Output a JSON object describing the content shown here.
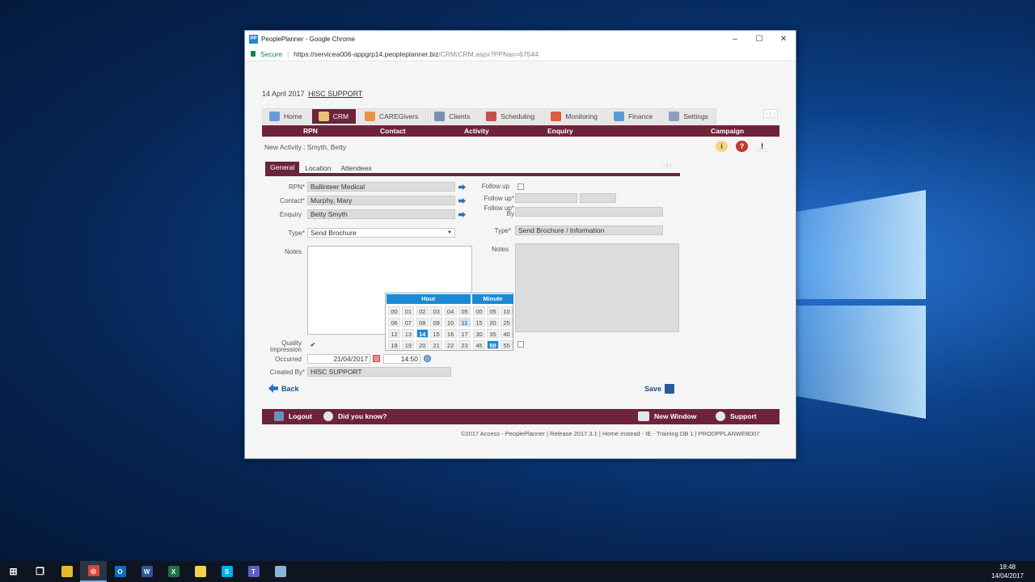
{
  "window": {
    "title": "PeoplePlanner - Google Chrome",
    "logo": "PP",
    "min": "–",
    "max": "☐",
    "close": "✕"
  },
  "address": {
    "secure": "Secure",
    "url_base": "https://servicea006-appgrp14.peopleplanner.biz",
    "url_path": "/CRM/CRM.aspx?PPNav=67544"
  },
  "header": {
    "date": "14 April 2017",
    "user": "HISC SUPPORT"
  },
  "tabs": [
    {
      "label": "Home",
      "icon": "home-icon",
      "color": "#6a9bd8"
    },
    {
      "label": "CRM",
      "icon": "people-icon",
      "color": "#e8c07a"
    },
    {
      "label": "CAREGivers",
      "icon": "person-icon",
      "color": "#e8934a"
    },
    {
      "label": "Clients",
      "icon": "building-icon",
      "color": "#7a8fb0"
    },
    {
      "label": "Scheduling",
      "icon": "calendar-icon",
      "color": "#c0504d"
    },
    {
      "label": "Monitoring",
      "icon": "clock-icon",
      "color": "#d9603b"
    },
    {
      "label": "Finance",
      "icon": "chart-icon",
      "color": "#5b9bd5"
    },
    {
      "label": "Settings",
      "icon": "gear-icon",
      "color": "#8aa0c0"
    }
  ],
  "nav_arrows": "‹ | ›",
  "subnav": [
    "RPN",
    "Contact",
    "Activity",
    "Enquiry",
    "Campaign"
  ],
  "breadcrumb": "New Activity : Smyth, Betty",
  "header_icons": {
    "info": "i",
    "help": "?",
    "warning": "!"
  },
  "form_tabs": [
    "General",
    "Location",
    "Attendees"
  ],
  "form": {
    "rpn_label": "RPN",
    "rpn": "Ballinteer Medical",
    "contact_label": "Contact",
    "contact": "Murphy, Mary",
    "enquiry_label": "Enquiry",
    "enquiry": "Betty Smyth",
    "type_label": "Type",
    "type": "Send Brochure",
    "notes_label": "Notes",
    "quality_label_1": "Quality",
    "quality_label_2": "Impression",
    "quality_check": "✔",
    "occurred_label": "Occurred",
    "occurred_date": "21/04/2017",
    "occurred_time": "14:50",
    "created_by_label": "Created By",
    "created_by": "HISC SUPPORT",
    "followup_label": "Follow up",
    "followup2_label": "Follow up",
    "followup_by_label_1": "Follow up",
    "followup_by_label_2": "By",
    "type2_label": "Type",
    "type2": "Send Brochure / Information",
    "notes2_label": "Notes",
    "required": "*",
    "select_arrow": "▼"
  },
  "picker": {
    "hour_label": "Hour",
    "minute_label": "Minute",
    "hours": [
      "00",
      "01",
      "02",
      "03",
      "04",
      "05",
      "06",
      "07",
      "08",
      "09",
      "10",
      "11",
      "12",
      "13",
      "14",
      "15",
      "16",
      "17",
      "18",
      "19",
      "20",
      "21",
      "22",
      "23"
    ],
    "minutes": [
      "00",
      "05",
      "10",
      "15",
      "20",
      "25",
      "30",
      "35",
      "40",
      "45",
      "50",
      "55"
    ],
    "selected_hour": "14",
    "selected_minute": "50",
    "hover_hour": "11"
  },
  "actions": {
    "back": "Back",
    "save": "Save"
  },
  "footer": {
    "logout": "Logout",
    "did_you_know": "Did you know?",
    "new_window": "New Window",
    "support": "Support"
  },
  "copyright": "©2017 Access - PeoplePlanner | Release 2017.3.1 | Home Instead - IE - Training DB 1 | PRODPPLANWEB007",
  "taskbar": {
    "items": [
      {
        "name": "start-icon",
        "color": "#ffffff",
        "glyph": "⊞"
      },
      {
        "name": "task-view-icon",
        "color": "#ffffff",
        "glyph": "❐"
      },
      {
        "name": "file-explorer-icon",
        "color": "#e8b830",
        "glyph": ""
      },
      {
        "name": "chrome-icon",
        "color": "#db4437",
        "glyph": "◎"
      },
      {
        "name": "outlook-icon",
        "color": "#0f6cbd",
        "glyph": "O"
      },
      {
        "name": "word-icon",
        "color": "#2b579a",
        "glyph": "W"
      },
      {
        "name": "excel-icon",
        "color": "#217346",
        "glyph": "X"
      },
      {
        "name": "sticky-notes-icon",
        "color": "#f2d14c",
        "glyph": ""
      },
      {
        "name": "skype-icon",
        "color": "#00aff0",
        "glyph": "S"
      },
      {
        "name": "teams-icon",
        "color": "#5b5fc7",
        "glyph": "T"
      },
      {
        "name": "app-icon",
        "color": "#8ab4d8",
        "glyph": ""
      }
    ],
    "time": "18:48",
    "date": "14/04/2017"
  }
}
